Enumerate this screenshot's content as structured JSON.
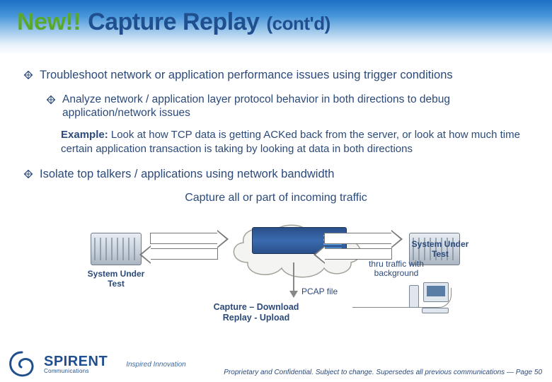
{
  "title": {
    "newTag": "New!!",
    "main": "Capture Replay",
    "cont": "(cont'd)"
  },
  "bullets": {
    "b1": "Troubleshoot network or application performance issues using trigger conditions",
    "b1a": "Analyze network / application layer protocol behavior in both directions to debug application/network issues",
    "exampleLabel": "Example:",
    "exampleText": " Look at how TCP data is getting ACKed back from the server, or look at how much time certain application transaction is taking by looking at data in both directions",
    "b2": "Isolate top talkers / applications using network bandwidth"
  },
  "diagram": {
    "caption": "Capture all or part of incoming traffic",
    "sutLeft": "System Under Test",
    "sutRight": "System Under Test",
    "thruLabel": "thru traffic with background",
    "pcap": "PCAP file",
    "captureReplayLine1": "Capture – Download",
    "captureReplayLine2": "Replay - Upload"
  },
  "footer": {
    "brand": "SPIRENT",
    "brandSub": "Communications",
    "tagline": "Inspired Innovation",
    "legal": "Proprietary and Confidential. Subject to change. Supersedes all previous communications — Page 50"
  }
}
